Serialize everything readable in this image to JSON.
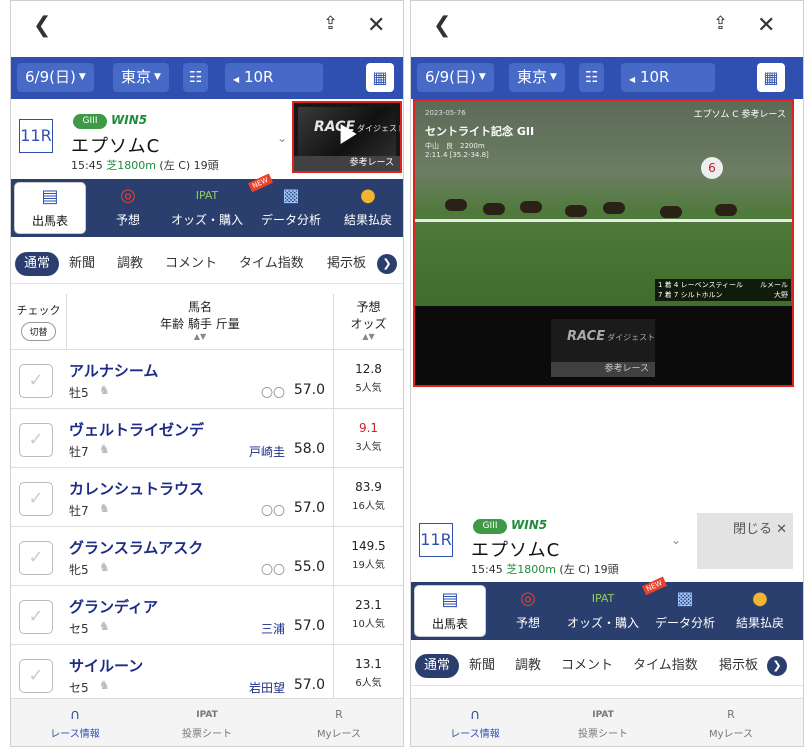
{
  "header": {
    "date": "6/9(日)",
    "venue": "東京",
    "race_no": "10R"
  },
  "race": {
    "number": "11R",
    "grade": "GIII",
    "win5": "WIN5",
    "name": "エプソムC",
    "time": "15:45",
    "distance": "芝1800m",
    "course": "(左 C) 19頭"
  },
  "thumbnail": {
    "logo": "RACE",
    "logo_sub": "ダイジェスト",
    "label": "参考レース"
  },
  "menu": [
    {
      "label": "出馬表",
      "icon": "table-icon"
    },
    {
      "label": "予想",
      "icon": "target-icon"
    },
    {
      "label": "オッズ・購入",
      "icon": "ipat-icon",
      "badge": "IPAT"
    },
    {
      "label": "データ分析",
      "icon": "chart-icon",
      "tag": "NEW"
    },
    {
      "label": "結果払戻",
      "icon": "coins-icon"
    }
  ],
  "tabs": [
    "通常",
    "新聞",
    "調教",
    "コメント",
    "タイム指数",
    "掲示板"
  ],
  "table_header": {
    "check": "チェック",
    "switch": "切替",
    "horse": "馬名",
    "sub": "年齢 騎手 斤量",
    "odds": "予想\nオッズ"
  },
  "horses": [
    {
      "name": "アルナシーム",
      "sex": "牡5",
      "jockey": "〇〇",
      "weight": "57.0",
      "odds": "12.8",
      "pop": "5人気"
    },
    {
      "name": "ヴェルトライゼンデ",
      "sex": "牡7",
      "jockey": "戸崎圭",
      "weight": "58.0",
      "odds": "9.1",
      "pop": "3人気",
      "hot": true
    },
    {
      "name": "カレンシュトラウス",
      "sex": "牡7",
      "jockey": "〇〇",
      "weight": "57.0",
      "odds": "83.9",
      "pop": "16人気"
    },
    {
      "name": "グランスラムアスク",
      "sex": "牝5",
      "jockey": "〇〇",
      "weight": "55.0",
      "odds": "149.5",
      "pop": "19人気"
    },
    {
      "name": "グランディア",
      "sex": "セ5",
      "jockey": "三浦",
      "weight": "57.0",
      "odds": "23.1",
      "pop": "10人気"
    },
    {
      "name": "サイルーン",
      "sex": "セ5",
      "jockey": "岩田望",
      "weight": "57.0",
      "odds": "13.1",
      "pop": "6人気"
    }
  ],
  "bottom_nav": [
    {
      "label": "レース情報",
      "icon": "horseshoe-icon"
    },
    {
      "label": "投票シート",
      "icon": "ipat-icon",
      "badge": "IPAT"
    },
    {
      "label": "Myレース",
      "icon": "my-race-icon",
      "badge": "R"
    }
  ],
  "video": {
    "date": "2023-05-76",
    "title": "セントライト記念 GII",
    "info1": "中山　良　2200m",
    "info2": "2:11.4 [35.2-34.8]",
    "tag": "エプソム C 参考レース",
    "leader1": "1 着 4 レーベンスティール",
    "leader1b": "ルメール",
    "leader2": "7 着 7 シルトホルン",
    "leader2b": "大野",
    "logo": "RACE",
    "logo_sub": "ダイジェスト",
    "ref": "参考レース"
  },
  "close_label": "閉じる"
}
